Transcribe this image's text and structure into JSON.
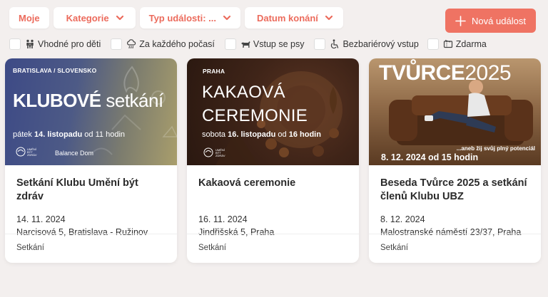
{
  "filters": [
    {
      "label": "Moje",
      "has_chevron": false
    },
    {
      "label": "Kategorie",
      "has_chevron": true
    },
    {
      "label": "Typ události: ...",
      "has_chevron": true
    },
    {
      "label": "Datum konání",
      "has_chevron": true
    }
  ],
  "new_event": {
    "label": "Nová událost",
    "icon": "plus-icon"
  },
  "checkboxes": [
    {
      "label": "Vhodné pro děti",
      "icon": "family-icon",
      "checked": false
    },
    {
      "label": "Za každého počasí",
      "icon": "cloud-rain-icon",
      "checked": false
    },
    {
      "label": "Vstup se psy",
      "icon": "dog-icon",
      "checked": false
    },
    {
      "label": "Bezbariérový vstup",
      "icon": "wheelchair-icon",
      "checked": false
    },
    {
      "label": "Zdarma",
      "icon": "ticket-icon",
      "checked": false
    }
  ],
  "cards": [
    {
      "title": "Setkání Klubu Umění být zdráv",
      "date": "14. 11. 2024",
      "address": "Narcisová 5, Bratislava - Ružinov",
      "category": "Setkání",
      "image": {
        "city": "BRATISLAVA / SLOVENSKO",
        "headline_bold": "KLUBOVÉ",
        "headline_light": "setkání",
        "day": "pátek",
        "date": "14. listopadu",
        "od": "od",
        "hour": "11 hodin",
        "logo_text": "UMĚNÍ BÝT ZDRÁV",
        "venue": "Balance Dom"
      }
    },
    {
      "title": "Kakaová ceremonie",
      "date": "16. 11. 2024",
      "address": "Jindřišská 5, Praha",
      "category": "Setkání",
      "image": {
        "city": "PRAHA",
        "line1": "KAKAOVÁ",
        "line2": "CEREMONIE",
        "day": "sobota",
        "date": "16. listopadu",
        "od": "od",
        "hour": "16 hodin",
        "logo_text": "UMĚNÍ BÝT ZDRÁV"
      }
    },
    {
      "title": "Beseda Tvůrce 2025 a setkání členů Klubu UBZ",
      "date": "8. 12. 2024",
      "address": "Malostranské náměstí 23/37, Praha",
      "category": "Setkání",
      "image": {
        "brand": "TVŮRCE",
        "year": "2025",
        "tagline": "...aneb žij svůj plný potenciál",
        "date_line": "8. 12. 2024 od 15 hodin"
      }
    }
  ],
  "colors": {
    "accent": "#ef7363",
    "background": "#f3efee"
  }
}
